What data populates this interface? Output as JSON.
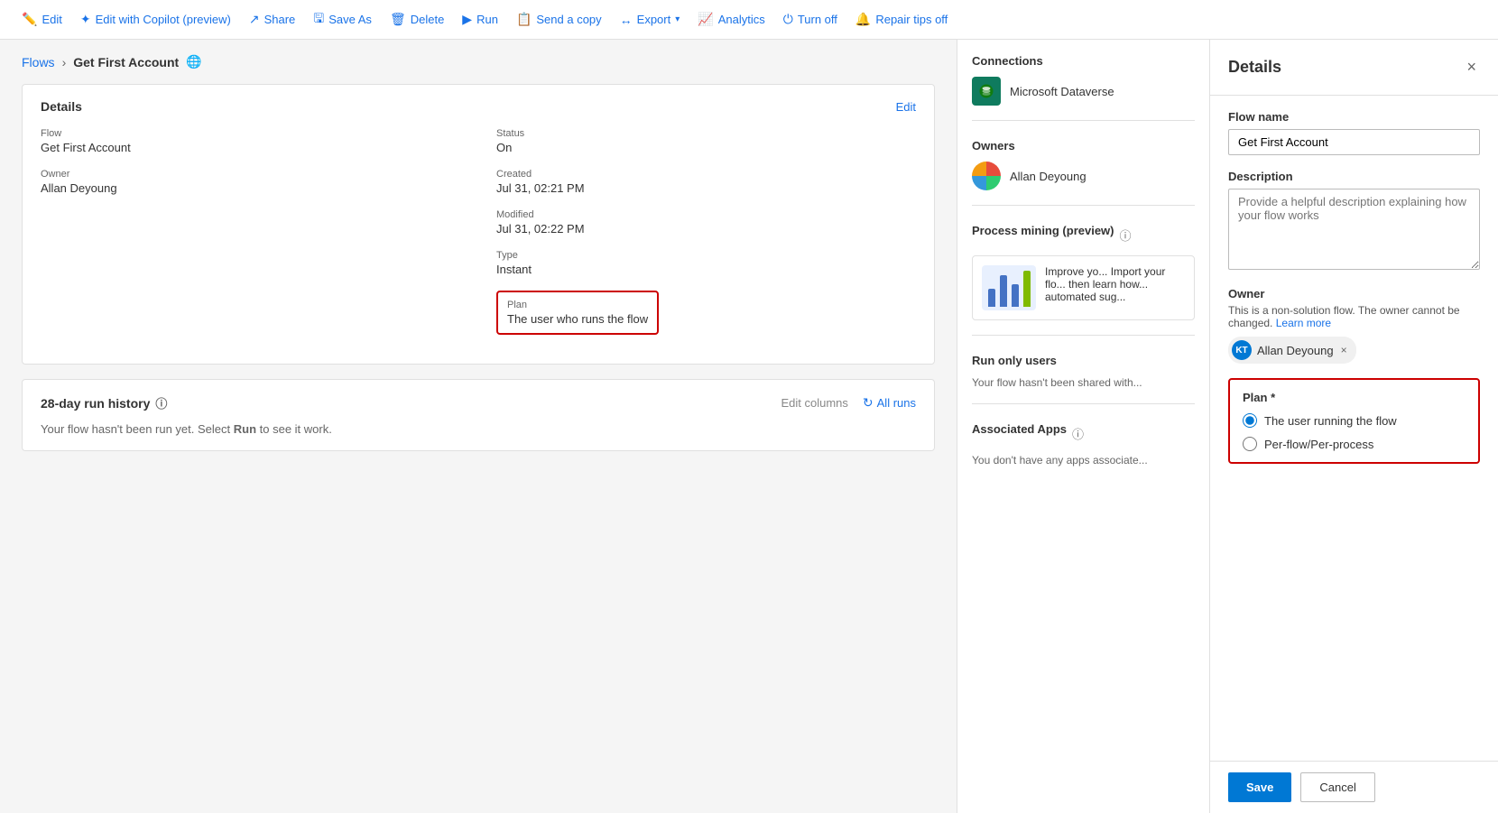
{
  "toolbar": {
    "items": [
      {
        "id": "edit",
        "label": "Edit",
        "icon": "✏️"
      },
      {
        "id": "edit-copilot",
        "label": "Edit with Copilot (preview)",
        "icon": "✦"
      },
      {
        "id": "share",
        "label": "Share",
        "icon": "↗"
      },
      {
        "id": "save-as",
        "label": "Save As",
        "icon": "🖫"
      },
      {
        "id": "delete",
        "label": "Delete",
        "icon": "🗑"
      },
      {
        "id": "run",
        "label": "Run",
        "icon": "▶"
      },
      {
        "id": "send-copy",
        "label": "Send a copy",
        "icon": "📋"
      },
      {
        "id": "export",
        "label": "Export",
        "icon": "↔"
      },
      {
        "id": "analytics",
        "label": "Analytics",
        "icon": "📈"
      },
      {
        "id": "turn-off",
        "label": "Turn off",
        "icon": "⏻"
      },
      {
        "id": "repair-tips",
        "label": "Repair tips off",
        "icon": "🔔"
      }
    ]
  },
  "breadcrumb": {
    "parent": "Flows",
    "current": "Get First Account"
  },
  "details_card": {
    "title": "Details",
    "edit_label": "Edit",
    "flow_label": "Flow",
    "flow_value": "Get First Account",
    "owner_label": "Owner",
    "owner_value": "Allan Deyoung",
    "status_label": "Status",
    "status_value": "On",
    "created_label": "Created",
    "created_value": "Jul 31, 02:21 PM",
    "modified_label": "Modified",
    "modified_value": "Jul 31, 02:22 PM",
    "type_label": "Type",
    "type_value": "Instant",
    "plan_label": "Plan",
    "plan_value": "The user who runs the flow"
  },
  "run_history": {
    "title": "28-day run history",
    "edit_columns": "Edit columns",
    "all_runs": "All runs",
    "empty_message": "Your flow hasn't been run yet. Select ",
    "run_word": "Run",
    "empty_message_2": " to see it work."
  },
  "connections": {
    "title": "Connections",
    "items": [
      {
        "name": "Microsoft Dataverse",
        "icon": "⊙"
      }
    ]
  },
  "owners": {
    "title": "Owners",
    "items": [
      {
        "name": "Allan Deyoung"
      }
    ]
  },
  "process_mining": {
    "title": "Process mining (preview)",
    "description": "Improve yo... Import your flo... then learn how... automated sug..."
  },
  "run_only_users": {
    "title": "Run only users",
    "message": "Your flow hasn't been shared with..."
  },
  "associated_apps": {
    "title": "Associated Apps",
    "message": "You don't have any apps associate..."
  },
  "details_panel": {
    "title": "Details",
    "close_label": "×",
    "flow_name_label": "Flow name",
    "flow_name_value": "Get First Account",
    "description_label": "Description",
    "description_placeholder": "Provide a helpful description explaining how your flow works",
    "owner_label": "Owner",
    "owner_desc_1": "This is a non-solution flow. The owner cannot be changed.",
    "owner_learn_more": "Learn more",
    "owner_name": "Allan Deyoung",
    "owner_initials": "KT",
    "plan_label": "Plan *",
    "plan_options": [
      {
        "id": "user-running",
        "label": "The user running the flow",
        "selected": true
      },
      {
        "id": "per-flow",
        "label": "Per-flow/Per-process",
        "selected": false
      }
    ],
    "save_label": "Save",
    "cancel_label": "Cancel"
  }
}
